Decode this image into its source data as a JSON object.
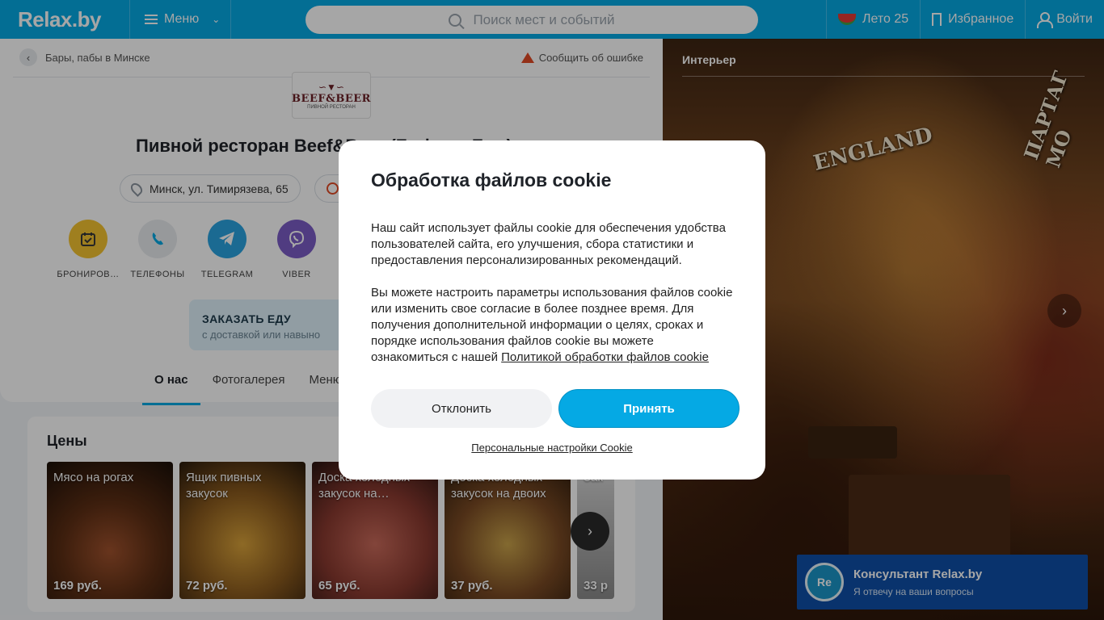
{
  "header": {
    "logo": "Relax.by",
    "menu_label": "Меню",
    "search_placeholder": "Поиск мест и событий",
    "summer_label": "Лето 25",
    "favorites_label": "Избранное",
    "login_label": "Войти"
  },
  "page": {
    "breadcrumb": "Бары, пабы в Минске",
    "report_error": "Сообщить об ошибке",
    "venue_logo": {
      "top": "BEEF",
      "mid": "BEER",
      "sub": "ПИВНОЙ РЕСТОРАН"
    },
    "title": "Пивной ресторан Beef&Beer (Бифэнд Бир)",
    "address": "Минск, ул. Тимирязева, 65",
    "actions": [
      {
        "label": "БРОНИРОВ…",
        "icon": "calendar-icon",
        "color": "#f4c430"
      },
      {
        "label": "ТЕЛЕФОНЫ",
        "icon": "phone-icon",
        "color": "#e8ebef"
      },
      {
        "label": "TELEGRAM",
        "icon": "telegram-icon",
        "color": "#2aa4e0"
      },
      {
        "label": "VIBER",
        "icon": "viber-icon",
        "color": "#7b5cc6"
      }
    ],
    "order_title": "ЗАКАЗАТЬ ЕДУ",
    "order_subtitle": "с доставкой или навыно",
    "tabs": [
      "О нас",
      "Фотогалерея",
      "Меню и"
    ]
  },
  "prices": {
    "title": "Цены",
    "items": [
      {
        "name": "Мясо на рогах",
        "price": "169 руб."
      },
      {
        "name": "Ящик пивных закусок",
        "price": "72 руб."
      },
      {
        "name": "Доска холодных закусок на…",
        "price": "65 руб."
      },
      {
        "name": "Доска холодных закусок на двоих",
        "price": "37 руб."
      },
      {
        "name": "Зак",
        "price": "33 р"
      }
    ]
  },
  "gallery": {
    "label": "Интерьер",
    "banner_text": "ENGLAND",
    "banner_text2": "ПАРТАГ МО"
  },
  "cookie": {
    "title": "Обработка файлов cookie",
    "para1": "Наш сайт использует файлы cookie для обеспечения удобства пользователей сайта, его улучшения, сбора статистики и предоставления персонализированных рекомендаций.",
    "para2": "Вы можете настроить параметры использования файлов cookie или изменить свое согласие в более позднее время. Для получения дополнительной информации о целях, сроках и порядке использования файлов cookie вы можете ознакомиться с нашей",
    "policy_link": "Политикой обработки файлов cookie",
    "decline": "Отклонить",
    "accept": "Принять",
    "settings_link": "Персональные настройки Cookie"
  },
  "consultant": {
    "avatar": "Re",
    "title": "Консультант Relax.by",
    "subtitle": "Я отвечу на ваши вопросы"
  },
  "colors": {
    "brand": "#05a9e4",
    "accent_red": "#e24b26",
    "consultant_bg": "#0f4fa8"
  }
}
